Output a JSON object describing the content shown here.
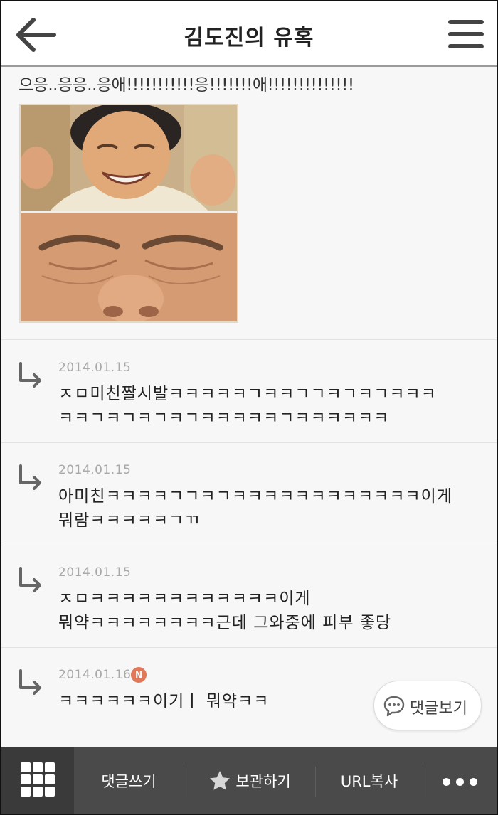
{
  "header": {
    "title": "김도진의 유혹"
  },
  "post": {
    "text": "으응..응응..응애!!!!!!!!!!!응!!!!!!!애!!!!!!!!!!!!!!"
  },
  "comments": [
    {
      "date": "2014.01.15",
      "text": "ㅈㅁ미친짤시발ㅋㅋㅋㅋㅋㄱㅋㅋㄱㄱㅋㄱㅋㄱㅋㅋㅋ\nㅋㅋㄱㅋㄱㅋㄱㅋㄱㅋㅋㅋㅋㅋㄱㅋㅋㅋㅋㅋㅋ",
      "is_new": false
    },
    {
      "date": "2014.01.15",
      "text": "아미친ㅋㅋㅋㅋㄱㄱㅋㄱㅋㅋㅋㅋㅋㅋㅋㅋㅋㅋㅋㅋ이게\n뭐람ㅋㅋㅋㅋㅋㄱㄲ",
      "is_new": false
    },
    {
      "date": "2014.01.15",
      "text": "ㅈㅁㅋㅋㅋㅋㅋㅋㅋㅋㅋㅋㅋㅋ이게\n뭐약ㅋㅋㅋㅋㅋㅋㅋㅋ근데 그와중에 피부 좋당",
      "is_new": false
    },
    {
      "date": "2014.01.16",
      "text": "ㅋㅋㅋㅋㅋㅋ이기ㅣ 뭐약ㅋㅋ",
      "is_new": true,
      "badge": "N"
    }
  ],
  "view_comments_label": "댓글보기",
  "bottom_bar": {
    "write_comment": "댓글쓰기",
    "save": "보관하기",
    "copy_url": "URL복사"
  },
  "colors": {
    "badge": "#e0785a",
    "bottom_bar": "#4a4a4a"
  },
  "icons": [
    "back-arrow-icon",
    "hamburger-menu-icon",
    "reply-arrow-icon",
    "chat-bubble-icon",
    "grid-icon",
    "star-icon",
    "more-dots-icon"
  ]
}
